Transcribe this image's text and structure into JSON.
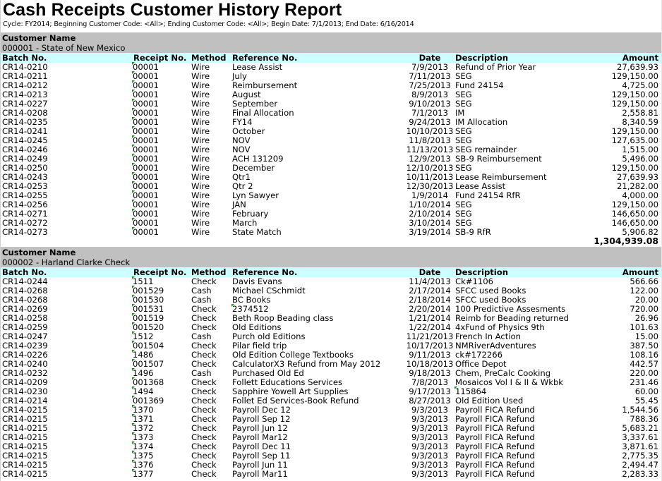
{
  "report": {
    "title": "Cash Receipts Customer History Report",
    "parameters": "Cycle: FY2014; Beginning Customer Code: <All>; Ending Customer Code: <All>; Begin Date: 7/1/2013; End Date: 6/16/2014",
    "customer_label": "Customer Name",
    "columns": {
      "batch": "Batch No.",
      "receipt": "Receipt No.",
      "method": "Method",
      "reference": "Reference No.",
      "date": "Date",
      "description": "Description",
      "amount": "Amount"
    },
    "flag_color": "#1f8f1f",
    "customers": [
      {
        "name": "000001 - State of New Mexico",
        "total": "1,304,939.08",
        "rows": [
          {
            "batch": "CR14-0210",
            "receipt": "00001",
            "method": "Wire",
            "reference": "Lease Assist",
            "date": "7/9/2013",
            "description": "Refund of Prior Year",
            "amount": "27,639.93"
          },
          {
            "batch": "CR14-0211",
            "receipt": "00001",
            "method": "Wire",
            "reference": "July",
            "date": "7/11/2013",
            "description": "SEG",
            "amount": "129,150.00"
          },
          {
            "batch": "CR14-0212",
            "receipt": "00001",
            "method": "Wire",
            "reference": "Reimbursement",
            "date": "7/25/2013",
            "description": "Fund 24154",
            "amount": "4,725.00"
          },
          {
            "batch": "CR14-0213",
            "receipt": "00001",
            "method": "Wire",
            "reference": "August",
            "date": "8/9/2013",
            "description": "SEG",
            "amount": "129,150.00"
          },
          {
            "batch": "CR14-0227",
            "receipt": "00001",
            "method": "Wire",
            "reference": "September",
            "date": "9/10/2013",
            "description": "SEG",
            "amount": "129,150.00"
          },
          {
            "batch": "CR14-0208",
            "receipt": "00001",
            "method": "Wire",
            "reference": "Final Allocation",
            "date": "7/1/2013",
            "description": "IM",
            "amount": "2,558.81"
          },
          {
            "batch": "CR14-0235",
            "receipt": "00001",
            "method": "Wire",
            "reference": "FY14",
            "date": "9/24/2013",
            "description": "IM Allocation",
            "amount": "8,340.59"
          },
          {
            "batch": "CR14-0241",
            "receipt": "00001",
            "method": "Wire",
            "reference": "October",
            "date": "10/10/2013",
            "description": "SEG",
            "amount": "129,150.00"
          },
          {
            "batch": "CR14-0245",
            "receipt": "00001",
            "method": "Wire",
            "reference": "NOV",
            "date": "11/8/2013",
            "description": "SEG",
            "amount": "127,635.00"
          },
          {
            "batch": "CR14-0246",
            "receipt": "00001",
            "method": "Wire",
            "reference": "NOV",
            "date": "11/13/2013",
            "description": "SEG remainder",
            "amount": "1,515.00"
          },
          {
            "batch": "CR14-0249",
            "receipt": "00001",
            "method": "Wire",
            "reference": "ACH 131209",
            "date": "12/9/2013",
            "description": "SB-9 Reimbursement",
            "amount": "5,496.00"
          },
          {
            "batch": "CR14-0250",
            "receipt": "00001",
            "method": "Wire",
            "reference": "December",
            "date": "12/10/2013",
            "description": "SEG",
            "amount": "129,150.00"
          },
          {
            "batch": "CR14-0243",
            "receipt": "00001",
            "method": "Wire",
            "reference": "Qtr1",
            "date": "10/11/2013",
            "description": "Lease Reimbursement",
            "amount": "27,639.93"
          },
          {
            "batch": "CR14-0253",
            "receipt": "00001",
            "method": "Wire",
            "reference": "Qtr 2",
            "date": "12/30/2013",
            "description": "Lease Assist",
            "amount": "21,282.00"
          },
          {
            "batch": "CR14-0255",
            "receipt": "00001",
            "method": "Wire",
            "reference": "Lyn Sawyer",
            "date": "1/9/2014",
            "description": "Fund 24154 RfR",
            "amount": "4,000.00"
          },
          {
            "batch": "CR14-0256",
            "receipt": "00001",
            "method": "Wire",
            "reference": "JAN",
            "date": "1/10/2014",
            "description": "SEG",
            "amount": "129,150.00"
          },
          {
            "batch": "CR14-0271",
            "receipt": "00001",
            "method": "Wire",
            "reference": "February",
            "date": "2/10/2014",
            "description": "SEG",
            "amount": "146,650.00"
          },
          {
            "batch": "CR14-0272",
            "receipt": "00001",
            "method": "Wire",
            "reference": "March",
            "date": "3/10/2014",
            "description": "SEG",
            "amount": "146,650.00"
          },
          {
            "batch": "CR14-0273",
            "receipt": "00001",
            "method": "Wire",
            "reference": "State Match",
            "date": "3/19/2014",
            "description": "SB-9 RfR",
            "amount": "5,906.82"
          }
        ]
      },
      {
        "name": "000002 - Harland Clarke Check",
        "rows": [
          {
            "batch": "CR14-0244",
            "receipt": "1511",
            "method": "Check",
            "reference": "Davis Evans",
            "date": "11/4/2013",
            "description": "Ck#1106",
            "amount": "566.66"
          },
          {
            "batch": "CR14-0268",
            "receipt": "001529",
            "method": "Cash",
            "reference": "Michael CSchmidt",
            "date": "2/17/2014",
            "description": "SFCC used Books",
            "amount": "122.00"
          },
          {
            "batch": "CR14-0268",
            "receipt": "001530",
            "method": "Cash",
            "reference": "BC Books",
            "date": "2/18/2014",
            "description": "SFCC used Books",
            "amount": "20.00"
          },
          {
            "batch": "CR14-0269",
            "receipt": "001531",
            "method": "Check",
            "reference": "2374512",
            "reference_flag": true,
            "date": "2/20/2014",
            "description": "100 Predictive Assesments",
            "amount": "720.00"
          },
          {
            "batch": "CR14-0258",
            "receipt": "001519",
            "method": "Check",
            "reference": "Beth Roop Beading class",
            "date": "1/21/2014",
            "description": "Reimb for Beading returned",
            "amount": "26.96"
          },
          {
            "batch": "CR14-0259",
            "receipt": "001520",
            "method": "Check",
            "reference": "Old Editions",
            "date": "1/22/2014",
            "description": "4xFund of Physics 9th",
            "amount": "101.63"
          },
          {
            "batch": "CR14-0247",
            "receipt": "1512",
            "method": "Cash",
            "reference": "Purch old Editions",
            "date": "11/21/2013",
            "description": "French In Action",
            "amount": "15.00"
          },
          {
            "batch": "CR14-0239",
            "receipt": "001504",
            "method": "Check",
            "reference": "Pilar field trip",
            "date": "10/17/2013",
            "description": "NMRiverAdventures",
            "amount": "387.50"
          },
          {
            "batch": "CR14-0226",
            "receipt": "1486",
            "method": "Check",
            "reference": "Old Edition College Textbooks",
            "date": "9/11/2013",
            "description": "ck#172266",
            "amount": "108.16"
          },
          {
            "batch": "CR14-0240",
            "receipt": "001507",
            "method": "Check",
            "reference": "CalculatorX3 Refund from May 2012",
            "date": "10/18/2013",
            "description": "Office Depot",
            "amount": "442.57"
          },
          {
            "batch": "CR14-0232",
            "receipt": "1496",
            "method": "Cash",
            "reference": "Purchased Old Ed",
            "date": "9/18/2013",
            "description": "Chem, PreCalc Cooking",
            "amount": "220.00"
          },
          {
            "batch": "CR14-0209",
            "receipt": "001368",
            "method": "Check",
            "reference": "Follett Educations Services",
            "date": "7/8/2013",
            "description": "Mosaicos Vol I & II & Wkbk",
            "amount": "231.46"
          },
          {
            "batch": "CR14-0230",
            "receipt": "1494",
            "method": "Check",
            "reference": "Sapphire Yowell Art Supplies",
            "date": "9/17/2013",
            "description": "115864",
            "description_flag": true,
            "amount": "60.00"
          },
          {
            "batch": "CR14-0214",
            "receipt": "001369",
            "method": "Check",
            "reference": "Follet Ed Services-Book Refund",
            "date": "8/27/2013",
            "description": "Old Edition Used",
            "amount": "55.45"
          },
          {
            "batch": "CR14-0215",
            "receipt": "1370",
            "method": "Check",
            "reference": "Payroll Dec 12",
            "date": "9/3/2013",
            "description": "Payroll FICA Refund",
            "amount": "1,544.56"
          },
          {
            "batch": "CR14-0215",
            "receipt": "1371",
            "method": "Check",
            "reference": "Payroll Sep 12",
            "date": "9/3/2013",
            "description": "Payroll FICA Refund",
            "amount": "788.36"
          },
          {
            "batch": "CR14-0215",
            "receipt": "1372",
            "method": "Check",
            "reference": "Payroll Jun 12",
            "date": "9/3/2013",
            "description": "Payroll FICA Refund",
            "amount": "5,683.21"
          },
          {
            "batch": "CR14-0215",
            "receipt": "1373",
            "method": "Check",
            "reference": "Payroll Mar12",
            "date": "9/3/2013",
            "description": "Payroll FICA Refund",
            "amount": "3,337.61"
          },
          {
            "batch": "CR14-0215",
            "receipt": "1374",
            "method": "Check",
            "reference": "Payroll Dec 11",
            "date": "9/3/2013",
            "description": "Payroll FICA Refund",
            "amount": "3,871.61"
          },
          {
            "batch": "CR14-0215",
            "receipt": "1375",
            "method": "Check",
            "reference": "Payroll Sep 11",
            "date": "9/3/2013",
            "description": "Payroll FICA Refund",
            "amount": "2,775.35"
          },
          {
            "batch": "CR14-0215",
            "receipt": "1376",
            "method": "Check",
            "reference": "Payroll Jun 11",
            "date": "9/3/2013",
            "description": "Payroll FICA Refund",
            "amount": "2,494.47"
          },
          {
            "batch": "CR14-0215",
            "receipt": "1377",
            "method": "Check",
            "reference": "Payroll Mar11",
            "date": "9/3/2013",
            "description": "Payroll FICA Refund",
            "amount": "2,283.33"
          }
        ]
      }
    ]
  }
}
